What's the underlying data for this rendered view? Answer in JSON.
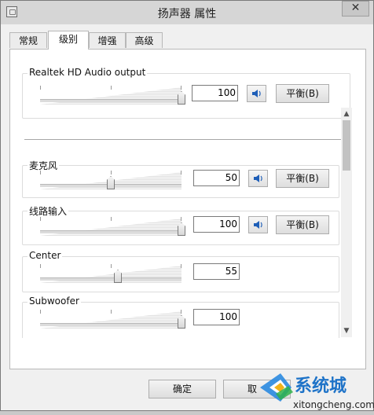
{
  "window": {
    "title": "扬声器 属性",
    "close": "✕"
  },
  "tabs": [
    {
      "label": "常规"
    },
    {
      "label": "级别",
      "active": true
    },
    {
      "label": "增强"
    },
    {
      "label": "高级"
    }
  ],
  "master": {
    "label": "Realtek HD Audio output",
    "value": "100",
    "level": 100,
    "balance": "平衡(B)"
  },
  "channels": [
    {
      "label": "麦克风",
      "value": "50",
      "level": 50,
      "mute": true,
      "balance": "平衡(B)"
    },
    {
      "label": "线路输入",
      "value": "100",
      "level": 100,
      "mute": true,
      "balance": "平衡(B)"
    },
    {
      "label": "Center",
      "value": "55",
      "level": 55
    },
    {
      "label": "Subwoofer",
      "value": "100",
      "level": 100
    }
  ],
  "footer": {
    "ok": "确定",
    "cancel": "取"
  },
  "watermark": {
    "brand": "系统城",
    "url": "xitongcheng.com"
  },
  "colors": {
    "speaker_blue": "#1f5fb8",
    "brand_blue": "#1e73c8"
  }
}
